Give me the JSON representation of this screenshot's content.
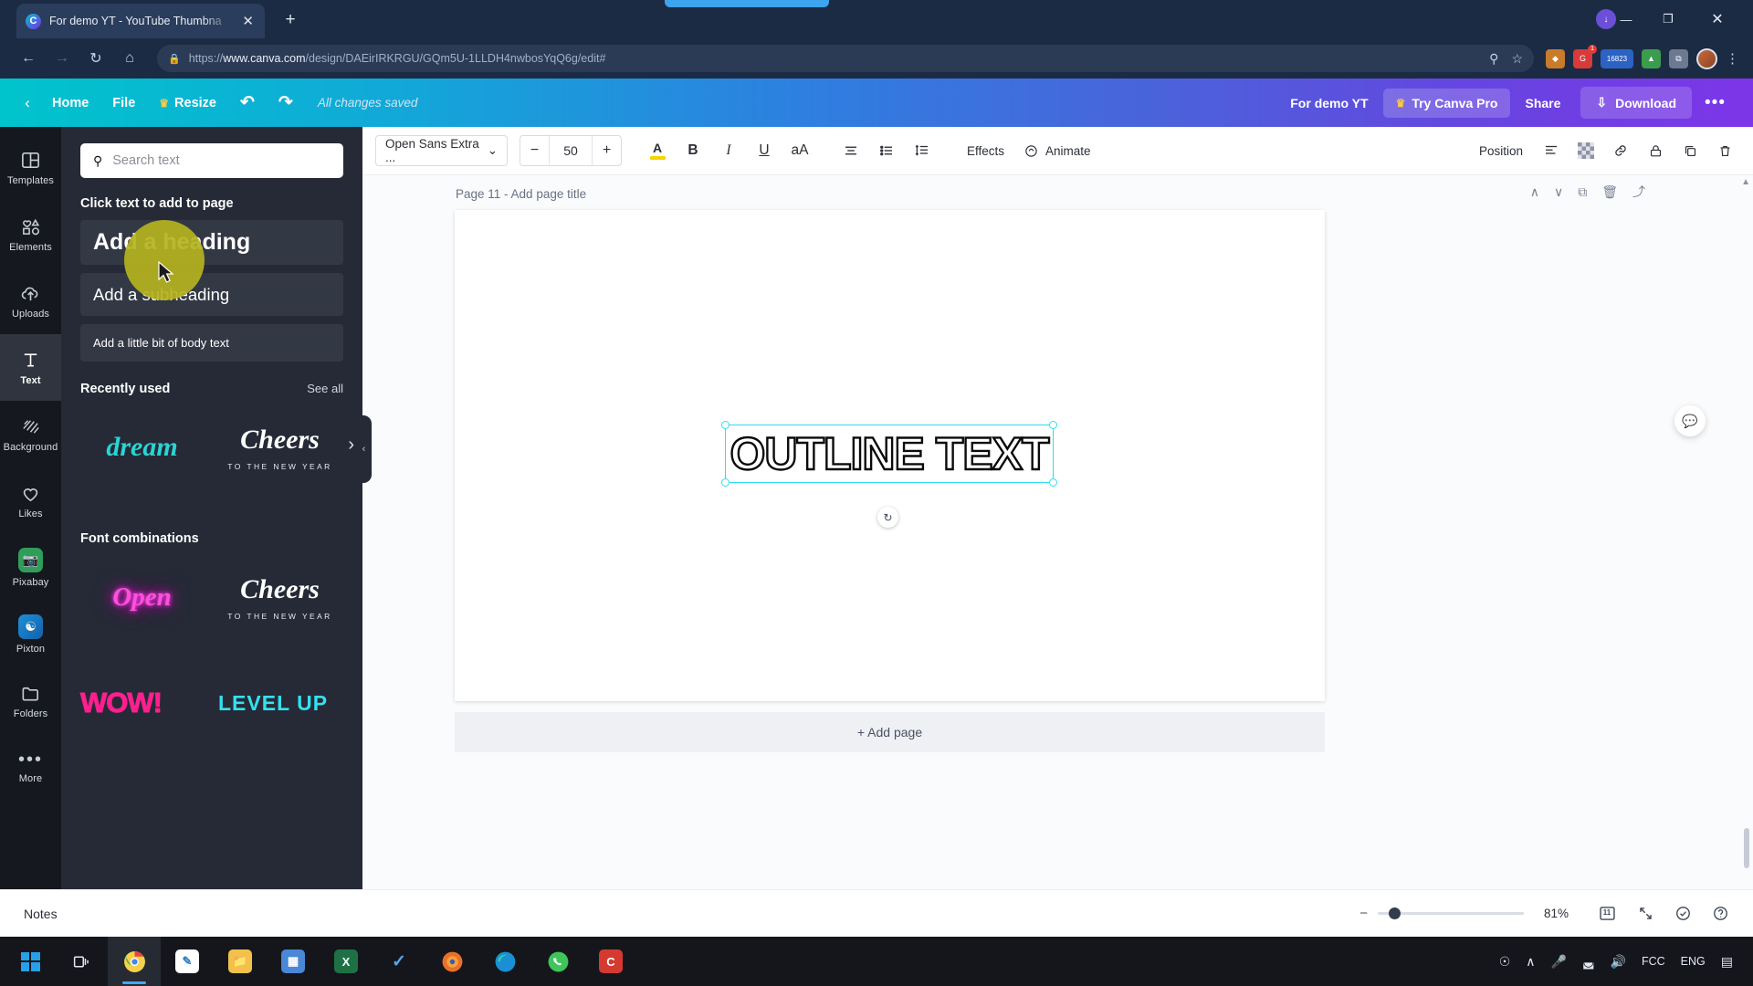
{
  "browser": {
    "tab": {
      "title": "For demo YT - YouTube Thumbna",
      "favicon": "canva-icon",
      "close": "✕"
    },
    "new_tab": "+",
    "nav": {
      "back": "←",
      "forward": "→",
      "reload": "↻",
      "home": "⌂"
    },
    "url": {
      "lock": "ὑ2",
      "scheme": "https://",
      "host": "www.canva.com",
      "path": "/design/DAEirIRKRGU/GQm5U-1LLDH4nwbosYqQ6g/edit#"
    },
    "omni_icons": {
      "search": "⚲",
      "bookmark": "☆"
    },
    "extensions": [
      {
        "name": "puzzle-extension-icon",
        "glyph": "◆",
        "color": "#c97b2a",
        "badge": ""
      },
      {
        "name": "grammarly-extension-icon",
        "glyph": "G",
        "color": "#d83a3a",
        "badge": "1"
      },
      {
        "name": "counter-extension-icon",
        "glyph": "16823",
        "color": "#2b62c4",
        "badge": ""
      },
      {
        "name": "shield-extension-icon",
        "glyph": "▲",
        "color": "#3a9d4e",
        "badge": ""
      },
      {
        "name": "puzzle2-extension-icon",
        "glyph": "⧉",
        "color": "#6b7a90",
        "badge": ""
      }
    ],
    "download_badge": "↓",
    "profile": "avatar",
    "menu": "⋮",
    "window": {
      "minimize": "—",
      "maximize": "❐",
      "close": "✕"
    }
  },
  "header": {
    "back": "‹",
    "home": "Home",
    "file": "File",
    "resize": "Resize",
    "resize_icon": "crown-icon",
    "undo": "↶",
    "redo": "↷",
    "saved_status": "All changes saved",
    "design_title": "For demo YT",
    "try_pro": "Try Canva Pro",
    "try_pro_icon": "crown-icon",
    "share": "Share",
    "download": "Download",
    "download_icon": "download-icon",
    "more": "•••"
  },
  "rail": {
    "items": [
      {
        "label": "Templates",
        "icon": "templates-icon",
        "active": false
      },
      {
        "label": "Elements",
        "icon": "elements-icon",
        "active": false
      },
      {
        "label": "Uploads",
        "icon": "upload-cloud-icon",
        "active": false
      },
      {
        "label": "Text",
        "icon": "text-icon",
        "active": true
      },
      {
        "label": "Background",
        "icon": "background-icon",
        "active": false
      },
      {
        "label": "Likes",
        "icon": "heart-icon",
        "active": false
      },
      {
        "label": "Pixabay",
        "icon": "pixabay-icon",
        "active": false
      },
      {
        "label": "Pixton",
        "icon": "pixton-icon",
        "active": false
      },
      {
        "label": "Folders",
        "icon": "folder-icon",
        "active": false
      },
      {
        "label": "More",
        "icon": "more-dots-icon",
        "active": false
      }
    ]
  },
  "panel": {
    "search_placeholder": "Search text",
    "search_value": "",
    "search_icon": "search-icon",
    "click_hint": "Click text to add to page",
    "text_options": [
      {
        "label": "Add a heading",
        "style": "heading"
      },
      {
        "label": "Add a subheading",
        "style": "subheading"
      },
      {
        "label": "Add a little bit of body text",
        "style": "body"
      }
    ],
    "recently_used": {
      "title": "Recently used",
      "see_all": "See all",
      "items": [
        {
          "main": "dream",
          "sub": ""
        },
        {
          "main": "Cheers",
          "sub": "TO THE NEW YEAR"
        }
      ],
      "next_arrow": "›"
    },
    "font_combinations": {
      "title": "Font combinations",
      "items": [
        {
          "main": "Open",
          "sub": ""
        },
        {
          "main": "Cheers",
          "sub": "TO THE NEW YEAR"
        },
        {
          "main": "WOW!",
          "sub": ""
        },
        {
          "main": "LEVEL UP",
          "sub": ""
        }
      ]
    },
    "collapse_arrow": "‹"
  },
  "toolbar": {
    "font_name": "Open Sans Extra ...",
    "font_caret": "⌄",
    "size_minus": "−",
    "font_size": "50",
    "size_plus": "+",
    "text_color": "A",
    "bold": "B",
    "italic": "I",
    "underline": "U",
    "case": "aA",
    "align": "align-icon",
    "list": "bullet-list-icon",
    "spacing": "line-spacing-icon",
    "effects": "Effects",
    "animate": "Animate",
    "animate_icon": "animate-icon",
    "position": "Position",
    "arrange_icon": "arrange-icon",
    "transparency_icon": "transparency-icon",
    "link_icon": "link-icon",
    "lock_icon": "lock-icon",
    "duplicate_icon": "duplicate-icon",
    "delete_icon": "trash-icon"
  },
  "canvas": {
    "page_label": "Page 11 - Add page title",
    "page_tools": {
      "up": "∧",
      "down": "∨",
      "duplicate": "⧉",
      "delete": "Ὕ1",
      "export": "⤴"
    },
    "selected_text": "OUTLINE TEXT",
    "rotate_icon": "rotate-icon",
    "add_page": "+ Add page",
    "help_icon": "help-feedback-icon",
    "collapse_notes": "⌃"
  },
  "statusbar": {
    "notes": "Notes",
    "zoom_minus": "−",
    "zoom_level": "81%",
    "page_count": "11",
    "grid_icon": "pages-grid-icon",
    "fullscreen_icon": "fullscreen-icon",
    "check_icon": "check-circle-icon",
    "help_icon": "help-circle-icon"
  },
  "taskbar": {
    "start": "windows-start-icon",
    "apps": [
      {
        "name": "task-view",
        "glyph": "☰",
        "color": "#2a2e38"
      },
      {
        "name": "chrome-app",
        "glyph": "◔",
        "color": "#f0c040",
        "active": true
      },
      {
        "name": "paint-app",
        "glyph": "✎",
        "color": "#43a3dd"
      },
      {
        "name": "explorer-app",
        "glyph": "Ὄ1",
        "color": "#f3c14b"
      },
      {
        "name": "notes-app",
        "glyph": "▣",
        "color": "#4a87d6"
      },
      {
        "name": "excel-app",
        "glyph": "X",
        "color": "#1e7145"
      },
      {
        "name": "todo-app",
        "glyph": "✓",
        "color": "#3a7fd5"
      },
      {
        "name": "firefox-app",
        "glyph": "●",
        "color": "#e8702a"
      },
      {
        "name": "edge-app",
        "glyph": "◑",
        "color": "#2f8fd4"
      },
      {
        "name": "whatsapp-app",
        "glyph": "●",
        "color": "#3ec65a"
      },
      {
        "name": "canva-app",
        "glyph": "C",
        "color": "#d43a2f"
      }
    ],
    "tray": {
      "assist_icon": "assistant-icon",
      "chevron": "∧",
      "mic": "Ἲ4",
      "wifi": "◢",
      "volume": "ὐa",
      "lang": "ENG",
      "fcc": "FCC",
      "notifications": "▤"
    }
  }
}
